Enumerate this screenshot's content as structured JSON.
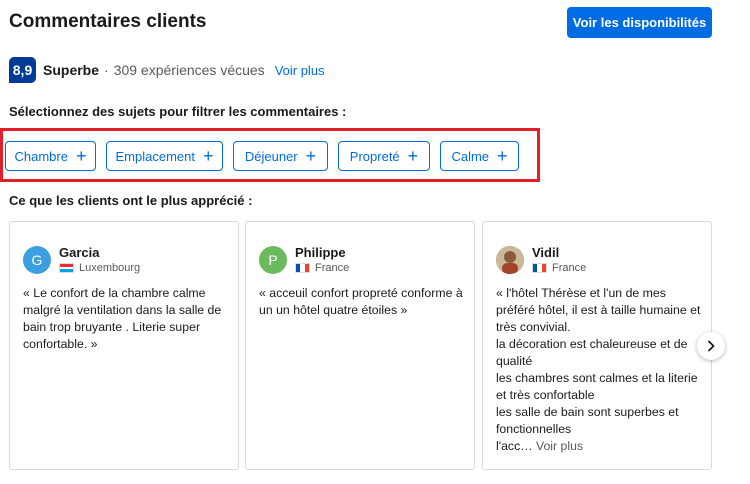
{
  "header": {
    "title": "Commentaires clients",
    "availability_button": "Voir les disponibilités"
  },
  "score": {
    "value": "8,9",
    "word": "Superbe",
    "separator": "·",
    "count_text": "309 expériences vécues",
    "more_link": "Voir plus"
  },
  "filters": {
    "heading": "Sélectionnez des sujets pour filtrer les commentaires :",
    "chips": [
      {
        "label": "Chambre",
        "icon": "+"
      },
      {
        "label": "Emplacement",
        "icon": "+"
      },
      {
        "label": "Déjeuner",
        "icon": "+"
      },
      {
        "label": "Propreté",
        "icon": "+"
      },
      {
        "label": "Calme",
        "icon": "+"
      }
    ]
  },
  "liked": {
    "heading": "Ce que les clients ont le plus apprécié :"
  },
  "reviews": [
    {
      "initial": "G",
      "avatar_color": "#3b9fe2",
      "name": "Garcia",
      "country": "Luxembourg",
      "text": "« Le confort de la chambre calme malgré la ventilation dans la salle de bain trop bruyante . Literie super confortable. »"
    },
    {
      "initial": "P",
      "avatar_color": "#6bba5e",
      "name": "Philippe",
      "country": "France",
      "text": "« acceuil confort propreté conforme à un un hôtel quatre étoiles »"
    },
    {
      "name": "Vidil",
      "country": "France",
      "lines": [
        "« l'hôtel Thérèse et l'un de mes préféré hôtel, il est à taille humaine et très convivial.",
        "la décoration est chaleureuse et de qualité",
        "les chambres sont calmes et la literie et très confortable",
        "les salle de bain sont superbes et fonctionnelles"
      ],
      "truncated": "l'acc…",
      "more_link": "Voir plus"
    }
  ],
  "carousel": {
    "next_icon": "chevron-right-icon"
  }
}
